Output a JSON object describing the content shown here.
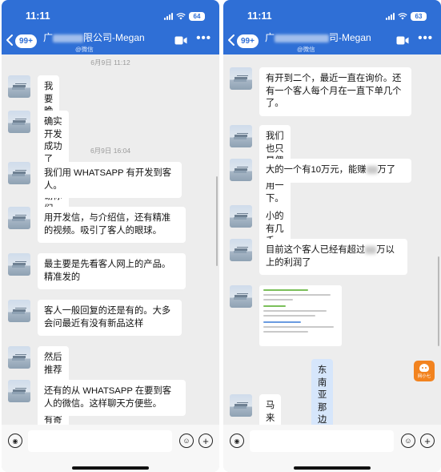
{
  "left": {
    "status": {
      "time": "11:11",
      "battery": "64"
    },
    "nav": {
      "badge": "99+",
      "title_start": "广",
      "title_end": "限公司-Megan",
      "subtitle": "@微信",
      "more": "•••"
    },
    "timestamps": [
      "6月9日 11:12",
      "6月9日 16:04"
    ],
    "messages": [
      "我要晚会和你讲哈",
      "确实开发成功了哈。很感谢你们",
      "我们用 WHATSAPP 有开发到客人。",
      "用开发信，与介绍信，还有精准的视频。吸引了客人的眼球。",
      "最主要是先看客人网上的产品。精准发的",
      "客人一般回复的还是有的。大多会问最近有没有新品这样",
      "然后推荐一些，就会有寄样这些",
      "还有的从 WHATSAPP 在要到客人的微信。这样聊天方便些。"
    ]
  },
  "right": {
    "status": {
      "time": "11:11",
      "battery": "63"
    },
    "nav": {
      "badge": "99+",
      "title_start": "广",
      "title_end": "司-Megan",
      "subtitle": "@微信",
      "more": "•••"
    },
    "messages": {
      "m1": "有开到二个，最近一直在询价。还有一个客人每个月在一直下单几个了。",
      "m2": "我们也只是偶尔来用一下。",
      "m3a": "大的一个有10万元，能赚",
      "m3b": "万了",
      "m4": "小的有几千元。",
      "m5a": "目前这个客人已经有超过",
      "m5b": "万以上的利润了",
      "my_msg": "东南亚那边的客户吗",
      "my_avatar_label": "网小七",
      "m6": "马来西亚的"
    }
  }
}
